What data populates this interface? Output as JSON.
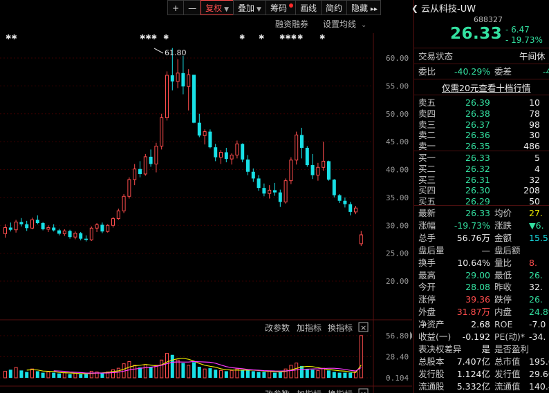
{
  "toolbar": {
    "plus": "+",
    "minus": "—",
    "fuquan": "复权",
    "diejia": "叠加",
    "chouma": "筹码",
    "huaxian": "画线",
    "jianyue": "简约",
    "yincang": "隐藏",
    "more": "▸▸"
  },
  "chart_header": {
    "margin_link": "融资融券",
    "ma_link": "设置均线"
  },
  "marks": [
    "✱✱",
    "✱✱✱",
    "✱",
    "✱",
    "✱",
    "✱✱✱",
    "✱",
    "✱"
  ],
  "peak_label": "61.80",
  "price_axis": [
    "60.00",
    "55.00",
    "50.00",
    "45.00",
    "40.00",
    "35.00",
    "30.00",
    "25.00",
    "20.00"
  ],
  "vol_axis": [
    "56.80",
    "28.40",
    "0.104"
  ],
  "sub_panel": {
    "params": "改参数",
    "add_ind": "加指标",
    "switch_ind": "换指标",
    "close": "×"
  },
  "chart_data": {
    "type": "candlestick",
    "ohlc": [
      [
        28.5,
        30.2,
        27.8,
        29.6
      ],
      [
        29.6,
        30.5,
        28.9,
        29.2
      ],
      [
        29.2,
        31.0,
        28.7,
        30.6
      ],
      [
        30.6,
        31.3,
        29.8,
        30.2
      ],
      [
        30.2,
        30.8,
        29.0,
        29.5
      ],
      [
        29.5,
        31.4,
        29.3,
        31.0
      ],
      [
        31.0,
        31.8,
        30.2,
        30.4
      ],
      [
        30.4,
        30.6,
        29.1,
        29.3
      ],
      [
        29.3,
        30.0,
        28.8,
        29.6
      ],
      [
        29.6,
        30.2,
        28.9,
        29.1
      ],
      [
        29.1,
        29.4,
        28.2,
        28.5
      ],
      [
        28.5,
        29.3,
        28.1,
        29.0
      ],
      [
        29.0,
        29.2,
        27.6,
        27.9
      ],
      [
        27.9,
        28.9,
        27.5,
        28.6
      ],
      [
        28.6,
        28.8,
        27.3,
        27.6
      ],
      [
        27.6,
        28.2,
        27.1,
        27.4
      ],
      [
        27.4,
        29.8,
        27.2,
        29.5
      ],
      [
        29.5,
        30.4,
        28.8,
        30.1
      ],
      [
        30.1,
        30.5,
        28.6,
        28.9
      ],
      [
        28.9,
        30.2,
        28.7,
        30.0
      ],
      [
        30.0,
        31.5,
        29.6,
        31.2
      ],
      [
        31.2,
        33.0,
        31.0,
        32.6
      ],
      [
        32.6,
        35.6,
        32.2,
        35.2
      ],
      [
        35.2,
        38.6,
        34.8,
        38.2
      ],
      [
        38.2,
        41.0,
        37.2,
        40.1
      ],
      [
        40.1,
        41.5,
        38.6,
        39.2
      ],
      [
        39.2,
        42.8,
        38.9,
        42.3
      ],
      [
        42.3,
        43.6,
        40.5,
        41.0
      ],
      [
        41.0,
        44.8,
        39.5,
        44.2
      ],
      [
        44.2,
        50.0,
        43.6,
        49.3
      ],
      [
        49.3,
        57.6,
        48.8,
        56.9
      ],
      [
        56.9,
        61.8,
        54.2,
        55.8
      ],
      [
        55.8,
        59.8,
        54.6,
        57.3
      ],
      [
        57.3,
        60.4,
        53.5,
        54.9
      ],
      [
        54.9,
        58.0,
        50.6,
        57.0
      ],
      [
        57.0,
        57.0,
        48.3,
        48.4
      ],
      [
        48.4,
        50.0,
        45.8,
        46.1
      ],
      [
        46.1,
        47.2,
        44.5,
        46.8
      ],
      [
        46.8,
        47.2,
        43.8,
        44.0
      ],
      [
        44.0,
        44.6,
        41.5,
        42.2
      ],
      [
        42.2,
        43.5,
        41.0,
        43.1
      ],
      [
        43.1,
        43.9,
        41.3,
        41.9
      ],
      [
        41.9,
        42.9,
        40.9,
        42.6
      ],
      [
        42.6,
        45.2,
        42.0,
        44.6
      ],
      [
        44.6,
        44.7,
        41.3,
        41.8
      ],
      [
        41.8,
        42.6,
        39.0,
        39.6
      ],
      [
        39.6,
        40.2,
        37.8,
        38.4
      ],
      [
        38.4,
        39.0,
        36.2,
        36.7
      ],
      [
        36.7,
        37.5,
        35.2,
        35.7
      ],
      [
        35.7,
        37.2,
        34.8,
        36.3
      ],
      [
        36.3,
        37.6,
        35.3,
        35.9
      ],
      [
        35.9,
        36.4,
        33.3,
        34.2
      ],
      [
        34.2,
        38.4,
        33.9,
        38.0
      ],
      [
        38.0,
        42.2,
        37.4,
        41.7
      ],
      [
        41.7,
        46.8,
        40.9,
        46.2
      ],
      [
        46.2,
        47.5,
        42.0,
        43.9
      ],
      [
        43.9,
        44.2,
        40.5,
        40.8
      ],
      [
        40.8,
        42.8,
        38.3,
        39.0
      ],
      [
        39.0,
        41.2,
        38.0,
        40.4
      ],
      [
        40.4,
        45.0,
        39.8,
        41.5
      ],
      [
        41.5,
        41.6,
        38.0,
        38.2
      ],
      [
        38.2,
        38.3,
        35.0,
        35.4
      ],
      [
        35.4,
        35.6,
        34.0,
        34.4
      ],
      [
        34.4,
        35.0,
        33.2,
        33.8
      ],
      [
        33.8,
        34.2,
        31.8,
        32.4
      ],
      [
        32.4,
        33.5,
        32.0,
        33.1
      ],
      [
        26.7,
        29.0,
        26.3,
        28.3
      ]
    ],
    "volume": [
      9,
      11,
      14,
      10,
      8,
      12,
      9,
      7,
      8,
      7,
      6,
      7,
      5,
      6,
      5,
      5,
      9,
      8,
      7,
      8,
      11,
      13,
      19,
      22,
      17,
      14,
      18,
      15,
      17,
      24,
      33,
      31,
      24,
      20,
      17,
      21,
      15,
      12,
      13,
      11,
      10,
      9,
      10,
      12,
      11,
      10,
      9,
      8,
      8,
      9,
      7,
      8,
      12,
      17,
      20,
      16,
      12,
      11,
      10,
      13,
      10,
      8,
      7,
      7,
      7,
      8,
      57
    ]
  },
  "stock": {
    "name": "云从科技-UW",
    "code": "688327",
    "price": "26.33",
    "change": "- 6.47",
    "change_pct": "- 19.73%"
  },
  "status": {
    "label": "交易状态",
    "value": "午间休"
  },
  "weibi": {
    "label1": "委比",
    "value1": "-40.29%",
    "label2": "委差",
    "value2": "-4"
  },
  "ten_levels_link": "仅需20元查看十档行情",
  "sells": [
    {
      "label": "卖五",
      "price": "26.39",
      "vol": "10"
    },
    {
      "label": "卖四",
      "price": "26.38",
      "vol": "78"
    },
    {
      "label": "卖三",
      "price": "26.37",
      "vol": "98"
    },
    {
      "label": "卖二",
      "price": "26.36",
      "vol": "30"
    },
    {
      "label": "卖一",
      "price": "26.35",
      "vol": "486"
    }
  ],
  "buys": [
    {
      "label": "买一",
      "price": "26.33",
      "vol": "5"
    },
    {
      "label": "买二",
      "price": "26.32",
      "vol": "4"
    },
    {
      "label": "买三",
      "price": "26.31",
      "vol": "32"
    },
    {
      "label": "买四",
      "price": "26.30",
      "vol": "208"
    },
    {
      "label": "买五",
      "price": "26.29",
      "vol": "50"
    }
  ],
  "stats": [
    {
      "l1": "最新",
      "v1": "26.33",
      "c1": "green",
      "l2": "均价",
      "v2": "27.",
      "c2": "yellow"
    },
    {
      "l1": "涨幅",
      "v1": "-19.73%",
      "c1": "green",
      "l2": "涨跌",
      "v2": "▼6.",
      "c2": "green"
    },
    {
      "l1": "总手",
      "v1": "56.76万",
      "c1": "white",
      "l2": "金额",
      "v2": "15.55",
      "c2": "cyan"
    },
    {
      "l1": "盘后量",
      "v1": "—",
      "c1": "white",
      "l2": "盘后额",
      "v2": "",
      "c2": "white"
    },
    {
      "l1": "换手",
      "v1": "10.64%",
      "c1": "white",
      "l2": "量比",
      "v2": "8.",
      "c2": "red"
    },
    {
      "l1": "最高",
      "v1": "29.00",
      "c1": "green",
      "l2": "最低",
      "v2": "26.",
      "c2": "green"
    },
    {
      "l1": "今开",
      "v1": "28.08",
      "c1": "green",
      "l2": "昨收",
      "v2": "32.",
      "c2": "white"
    },
    {
      "l1": "涨停",
      "v1": "39.36",
      "c1": "red",
      "l2": "跌停",
      "v2": "26.",
      "c2": "green"
    },
    {
      "l1": "外盘",
      "v1": "31.87万",
      "c1": "red",
      "l2": "内盘",
      "v2": "24.89",
      "c2": "green"
    },
    {
      "l1": "净资产",
      "v1": "2.68",
      "c1": "white",
      "l2": "ROE",
      "v2": "-7.0",
      "c2": "white"
    },
    {
      "l1": "收益(一)",
      "v1": "-0.192",
      "c1": "white",
      "l2": "PE(动)*",
      "v2": "-34.",
      "c2": "white"
    },
    {
      "l1": "表决权差异",
      "v1": "是",
      "c1": "white",
      "l2": "是否盈利",
      "v2": "",
      "c2": "white"
    },
    {
      "l1": "总股本",
      "v1": "7.407亿",
      "c1": "white",
      "l2": "总市值",
      "v2": "195.0",
      "c2": "white"
    },
    {
      "l1": "发行股",
      "v1": "1.124亿",
      "c1": "white",
      "l2": "发行值",
      "v2": "29.60",
      "c2": "white"
    },
    {
      "l1": "流通股",
      "v1": "5.332亿",
      "c1": "white",
      "l2": "流通值",
      "v2": "140.4",
      "c2": "white"
    }
  ],
  "colors": {
    "up": "#ff4d4d",
    "down": "#18e0e6",
    "ma1": "#e8e8e8",
    "ma2": "#e6e600",
    "ma3": "#ff3aff",
    "grid": "#3a0000"
  }
}
